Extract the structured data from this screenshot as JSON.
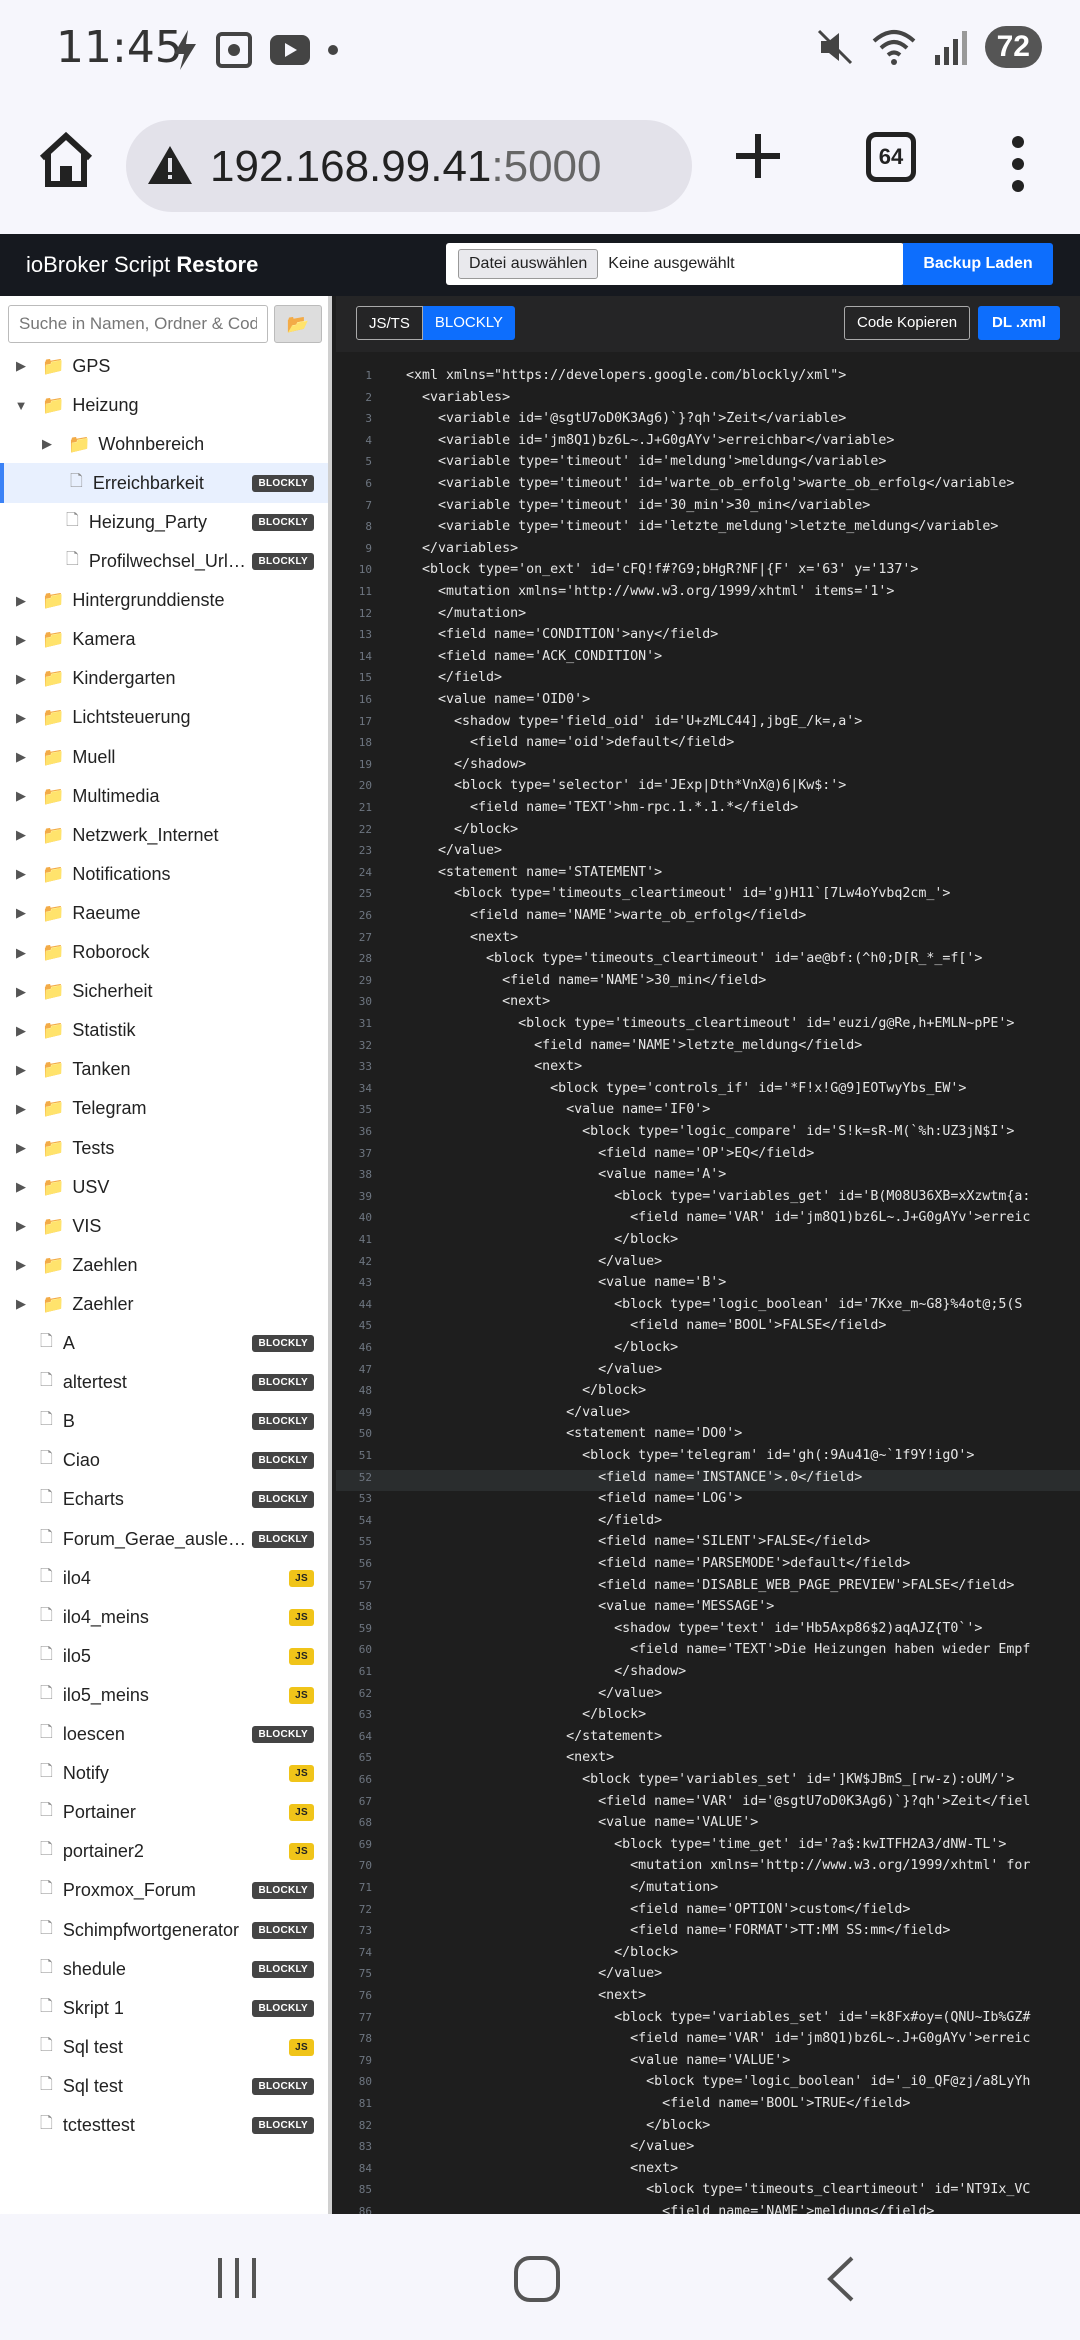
{
  "status_bar": {
    "time": "11:45",
    "battery": "72"
  },
  "browser": {
    "url_host": "192.168.99.41",
    "url_port": ":5000",
    "tab_count": "64"
  },
  "app": {
    "title_prefix": "ioBroker Script ",
    "title_bold": "Restore",
    "file_button": "Datei auswählen",
    "file_label": "Keine ausgewählt",
    "backup_button": "Backup Laden",
    "search_placeholder": "Suche in Namen, Ordner & Code",
    "mode_js": "JS/TS",
    "mode_blockly": "BLOCKLY",
    "copy_button": "Code Kopieren",
    "download_button": "DL .xml"
  },
  "tree": [
    {
      "type": "folder",
      "name": "GPS",
      "level": 0,
      "expanded": false
    },
    {
      "type": "folder",
      "name": "Heizung",
      "level": 0,
      "expanded": true
    },
    {
      "type": "folder",
      "name": "Wohnbereich",
      "level": 1,
      "expanded": false
    },
    {
      "type": "file",
      "name": "Erreichbarkeit",
      "level": 1,
      "badge": "BLOCKLY",
      "selected": true
    },
    {
      "type": "file",
      "name": "Heizung_Party",
      "level": 1,
      "badge": "BLOCKLY"
    },
    {
      "type": "file",
      "name": "Profilwechsel_Urlaub",
      "level": 1,
      "badge": "BLOCKLY"
    },
    {
      "type": "folder",
      "name": "Hintergrunddienste",
      "level": 0
    },
    {
      "type": "folder",
      "name": "Kamera",
      "level": 0
    },
    {
      "type": "folder",
      "name": "Kindergarten",
      "level": 0
    },
    {
      "type": "folder",
      "name": "Lichtsteuerung",
      "level": 0
    },
    {
      "type": "folder",
      "name": "Muell",
      "level": 0
    },
    {
      "type": "folder",
      "name": "Multimedia",
      "level": 0
    },
    {
      "type": "folder",
      "name": "Netzwerk_Internet",
      "level": 0
    },
    {
      "type": "folder",
      "name": "Notifications",
      "level": 0
    },
    {
      "type": "folder",
      "name": "Raeume",
      "level": 0
    },
    {
      "type": "folder",
      "name": "Roborock",
      "level": 0
    },
    {
      "type": "folder",
      "name": "Sicherheit",
      "level": 0
    },
    {
      "type": "folder",
      "name": "Statistik",
      "level": 0
    },
    {
      "type": "folder",
      "name": "Tanken",
      "level": 0
    },
    {
      "type": "folder",
      "name": "Telegram",
      "level": 0
    },
    {
      "type": "folder",
      "name": "Tests",
      "level": 0
    },
    {
      "type": "folder",
      "name": "USV",
      "level": 0
    },
    {
      "type": "folder",
      "name": "VIS",
      "level": 0
    },
    {
      "type": "folder",
      "name": "Zaehlen",
      "level": 0
    },
    {
      "type": "folder",
      "name": "Zaehler",
      "level": 0
    },
    {
      "type": "file",
      "name": "A",
      "level": 0,
      "badge": "BLOCKLY"
    },
    {
      "type": "file",
      "name": "altertest",
      "level": 0,
      "badge": "BLOCKLY"
    },
    {
      "type": "file",
      "name": "B",
      "level": 0,
      "badge": "BLOCKLY"
    },
    {
      "type": "file",
      "name": "Ciao",
      "level": 0,
      "badge": "BLOCKLY"
    },
    {
      "type": "file",
      "name": "Echarts",
      "level": 0,
      "badge": "BLOCKLY"
    },
    {
      "type": "file",
      "name": "Forum_Gerae_auslesen",
      "level": 0,
      "badge": "BLOCKLY"
    },
    {
      "type": "file",
      "name": "ilo4",
      "level": 0,
      "badge": "JS"
    },
    {
      "type": "file",
      "name": "ilo4_meins",
      "level": 0,
      "badge": "JS"
    },
    {
      "type": "file",
      "name": "ilo5",
      "level": 0,
      "badge": "JS"
    },
    {
      "type": "file",
      "name": "ilo5_meins",
      "level": 0,
      "badge": "JS"
    },
    {
      "type": "file",
      "name": "loescen",
      "level": 0,
      "badge": "BLOCKLY"
    },
    {
      "type": "file",
      "name": "Notify",
      "level": 0,
      "badge": "JS"
    },
    {
      "type": "file",
      "name": "Portainer",
      "level": 0,
      "badge": "JS"
    },
    {
      "type": "file",
      "name": "portainer2",
      "level": 0,
      "badge": "JS"
    },
    {
      "type": "file",
      "name": "Proxmox_Forum",
      "level": 0,
      "badge": "BLOCKLY"
    },
    {
      "type": "file",
      "name": "Schimpfwortgenerator",
      "level": 0,
      "badge": "BLOCKLY"
    },
    {
      "type": "file",
      "name": "shedule",
      "level": 0,
      "badge": "BLOCKLY"
    },
    {
      "type": "file",
      "name": "Skript 1",
      "level": 0,
      "badge": "BLOCKLY"
    },
    {
      "type": "file",
      "name": "Sql test",
      "level": 0,
      "badge": "JS"
    },
    {
      "type": "file",
      "name": "Sql test",
      "level": 0,
      "badge": "BLOCKLY"
    },
    {
      "type": "file",
      "name": "tctesttest",
      "level": 0,
      "badge": "BLOCKLY"
    }
  ],
  "code_lines": [
    "<xml xmlns=\"https://developers.google.com/blockly/xml\">",
    "  <variables>",
    "    <variable id='@sgtU7oD0K3Ag6)`}?qh'>Zeit</variable>",
    "    <variable id='jm8Q1)bz6L~.J+G0gAYv'>erreichbar</variable>",
    "    <variable type='timeout' id='meldung'>meldung</variable>",
    "    <variable type='timeout' id='warte_ob_erfolg'>warte_ob_erfolg</variable>",
    "    <variable type='timeout' id='30_min'>30_min</variable>",
    "    <variable type='timeout' id='letzte_meldung'>letzte_meldung</variable>",
    "  </variables>",
    "  <block type='on_ext' id='cFQ!f#?G9;bHgR?NF|{F' x='63' y='137'>",
    "    <mutation xmlns='http://www.w3.org/1999/xhtml' items='1'>",
    "    </mutation>",
    "    <field name='CONDITION'>any</field>",
    "    <field name='ACK_CONDITION'>",
    "    </field>",
    "    <value name='OID0'>",
    "      <shadow type='field_oid' id='U+zMLC44],jbgE_/k=,a'>",
    "        <field name='oid'>default</field>",
    "      </shadow>",
    "      <block type='selector' id='JExp|Dth*VnX@)6|Kw$:'>",
    "        <field name='TEXT'>hm-rpc.1.*.1.*</field>",
    "      </block>",
    "    </value>",
    "    <statement name='STATEMENT'>",
    "      <block type='timeouts_cleartimeout' id='g)H11`[7Lw4oYvbq2cm_'>",
    "        <field name='NAME'>warte_ob_erfolg</field>",
    "        <next>",
    "          <block type='timeouts_cleartimeout' id='ae@bf:(^h0;D[R_*_=f['>",
    "            <field name='NAME'>30_min</field>",
    "            <next>",
    "              <block type='timeouts_cleartimeout' id='euzi/g@Re,h+EMLN~pPE'>",
    "                <field name='NAME'>letzte_meldung</field>",
    "                <next>",
    "                  <block type='controls_if' id='*F!x!G@9]EOTwyYbs_EW'>",
    "                    <value name='IF0'>",
    "                      <block type='logic_compare' id='S!k=sR-M(`%h:UZ3jN$I'>",
    "                        <field name='OP'>EQ</field>",
    "                        <value name='A'>",
    "                          <block type='variables_get' id='B(M08U36XB=xXzwtm{a:",
    "                            <field name='VAR' id='jm8Q1)bz6L~.J+G0gAYv'>erreic",
    "                          </block>",
    "                        </value>",
    "                        <value name='B'>",
    "                          <block type='logic_boolean' id='7Kxe_m~G8}%4ot@;5(S",
    "                            <field name='BOOL'>FALSE</field>",
    "                          </block>",
    "                        </value>",
    "                      </block>",
    "                    </value>",
    "                    <statement name='DO0'>",
    "                      <block type='telegram' id='gh(:9Au41@~`1f9Y!igO'>",
    "                        <field name='INSTANCE'>.0</field>",
    "                        <field name='LOG'>",
    "                        </field>",
    "                        <field name='SILENT'>FALSE</field>",
    "                        <field name='PARSEMODE'>default</field>",
    "                        <field name='DISABLE_WEB_PAGE_PREVIEW'>FALSE</field>",
    "                        <value name='MESSAGE'>",
    "                          <shadow type='text' id='Hb5Axp86$2)aqAJZ{T0`'>",
    "                            <field name='TEXT'>Die Heizungen haben wieder Empf",
    "                          </shadow>",
    "                        </value>",
    "                      </block>",
    "                    </statement>",
    "                    <next>",
    "                      <block type='variables_set' id=']KW$JBmS_[rw-z):oUM/'>",
    "                        <field name='VAR' id='@sgtU7oD0K3Ag6)`}?qh'>Zeit</fiel",
    "                        <value name='VALUE'>",
    "                          <block type='time_get' id='?a$:kwITFH2A3/dNW-TL'>",
    "                            <mutation xmlns='http://www.w3.org/1999/xhtml' for",
    "                            </mutation>",
    "                            <field name='OPTION'>custom</field>",
    "                            <field name='FORMAT'>TT:MM SS:mm</field>",
    "                          </block>",
    "                        </value>",
    "                        <next>",
    "                          <block type='variables_set' id='=k8Fx#oy=(QNU~Ib%GZ#",
    "                            <field name='VAR' id='jm8Q1)bz6L~.J+G0gAYv'>erreic",
    "                            <value name='VALUE'>",
    "                              <block type='logic_boolean' id='_i0_QF@zj/a8LyYh",
    "                                <field name='BOOL'>TRUE</field>",
    "                              </block>",
    "                            </value>",
    "                            <next>",
    "                              <block type='timeouts_cleartimeout' id='NT9Ix_VC",
    "                                <field name='NAME'>meldung</field>"
  ],
  "highlighted_line": 52
}
